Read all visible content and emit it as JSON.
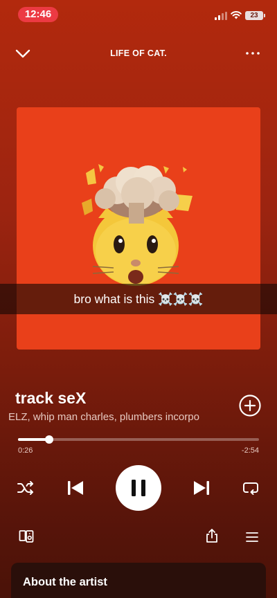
{
  "status_bar": {
    "time": "12:46",
    "battery": "23",
    "signal_icon": "cellular-signal-icon",
    "wifi_icon": "wifi-icon"
  },
  "header": {
    "context_title": "LIFE OF CAT.",
    "collapse_icon": "chevron-down-icon",
    "more_icon": "more-horizontal-icon"
  },
  "artwork": {
    "description_icon": "exploding-head-cat-emoji",
    "background_color": "#e9401a"
  },
  "caption": {
    "text": "bro what is this ☠️☠️☠️"
  },
  "track": {
    "title": "track seX",
    "artists": "ELZ, whip man charles, plumbers incorpo"
  },
  "progress": {
    "elapsed": "0:26",
    "remaining": "-2:54",
    "fraction": 0.13
  },
  "controls": {
    "shuffle_icon": "shuffle-icon",
    "previous_icon": "skip-previous-icon",
    "play_state_icon": "pause-icon",
    "next_icon": "skip-next-icon",
    "repeat_icon": "repeat-icon",
    "devices_icon": "connect-device-icon",
    "share_icon": "share-icon",
    "queue_icon": "queue-icon",
    "add_icon": "add-circle-icon"
  },
  "about_artist": {
    "title": "About the artist"
  },
  "colors": {
    "background_top": "#b2290d",
    "background_bottom": "#4a1208",
    "status_pill": "#ec3a43",
    "card": "#2a0f0a"
  }
}
